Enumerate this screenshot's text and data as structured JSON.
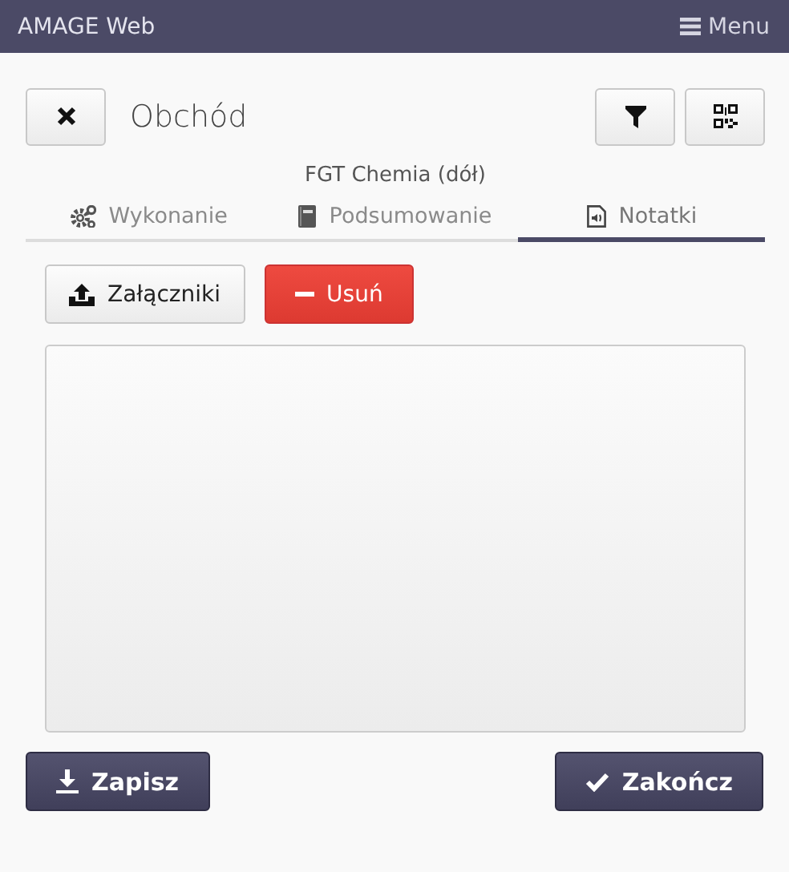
{
  "header": {
    "title": "AMAGE Web",
    "menu": "Menu"
  },
  "page": {
    "title": "Obchód",
    "subtitle": "FGT Chemia (dół)"
  },
  "tabs": [
    {
      "label": "Wykonanie",
      "selected": false
    },
    {
      "label": "Podsumowanie",
      "selected": false
    },
    {
      "label": "Notatki",
      "selected": true
    }
  ],
  "actions": {
    "attachments": "Załączniki",
    "delete": "Usuń"
  },
  "footer": {
    "save": "Zapisz",
    "finish": "Zakończ"
  }
}
